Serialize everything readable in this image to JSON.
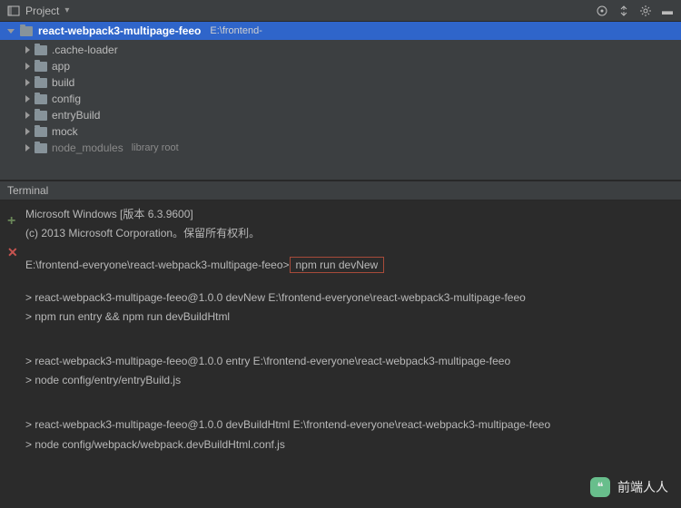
{
  "toolbar": {
    "project_label": "Project",
    "dropdown": "▾"
  },
  "root": {
    "name": "react-webpack3-multipage-feeo",
    "path": "E:\\frontend-"
  },
  "tree": [
    {
      "name": ".cache-loader"
    },
    {
      "name": "app"
    },
    {
      "name": "build"
    },
    {
      "name": "config"
    },
    {
      "name": "entryBuild"
    },
    {
      "name": "mock"
    },
    {
      "name": "node_modules",
      "lib": "library root"
    }
  ],
  "terminal": {
    "title": "Terminal",
    "lines": {
      "l1": "Microsoft Windows [版本 6.3.9600]",
      "l2": "(c) 2013 Microsoft Corporation。保留所有权利。",
      "l3a": "E:\\frontend-everyone\\react-webpack3-multipage-feeo>",
      "l3b": "npm run devNew",
      "l4": "> react-webpack3-multipage-feeo@1.0.0 devNew E:\\frontend-everyone\\react-webpack3-multipage-feeo",
      "l5": "> npm run entry && npm run devBuildHtml",
      "l6": "> react-webpack3-multipage-feeo@1.0.0 entry E:\\frontend-everyone\\react-webpack3-multipage-feeo",
      "l7": "> node config/entry/entryBuild.js",
      "l8": "> react-webpack3-multipage-feeo@1.0.0 devBuildHtml E:\\frontend-everyone\\react-webpack3-multipage-feeo",
      "l9": "> node config/webpack/webpack.devBuildHtml.conf.js"
    }
  },
  "watermark": {
    "text": "前端人人"
  }
}
